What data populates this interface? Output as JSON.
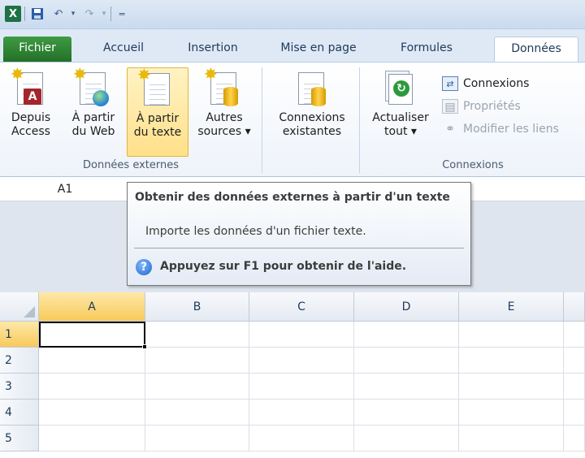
{
  "quick_access": {
    "app_icon": "excel-icon",
    "icons": [
      "save-icon",
      "undo-icon",
      "redo-icon",
      "customize-icon"
    ]
  },
  "tabs": {
    "file": "Fichier",
    "items": [
      "Accueil",
      "Insertion",
      "Mise en page",
      "Formules",
      "Données"
    ],
    "active": "Données"
  },
  "ribbon": {
    "groups": {
      "external_data": {
        "label": "Données externes",
        "buttons": [
          {
            "line1": "Depuis",
            "line2": "Access"
          },
          {
            "line1": "À partir",
            "line2": "du Web"
          },
          {
            "line1": "À partir",
            "line2": "du texte"
          },
          {
            "line1": "Autres",
            "line2": "sources ▾"
          }
        ]
      },
      "existing": {
        "line1": "Connexions",
        "line2": "existantes"
      },
      "connections": {
        "label": "Connexions",
        "refresh_line1": "Actualiser",
        "refresh_line2": "tout ▾",
        "connexions": "Connexions",
        "proprietes": "Propriétés",
        "modifier_liens": "Modifier les liens"
      }
    }
  },
  "namebox": {
    "value": "A1"
  },
  "tooltip": {
    "title": "Obtenir des données externes à partir d'un texte",
    "description": "Importe les données d'un fichier texte.",
    "help": "Appuyez sur F1 pour obtenir de l'aide."
  },
  "grid": {
    "columns": [
      "A",
      "B",
      "C",
      "D",
      "E"
    ],
    "rows": [
      "1",
      "2",
      "3",
      "4",
      "5"
    ],
    "selected_cell": "A1"
  },
  "colors": {
    "file_tab": "#2e8a35",
    "highlight": "#ffe08a",
    "selected_header": "#f8c95a"
  }
}
